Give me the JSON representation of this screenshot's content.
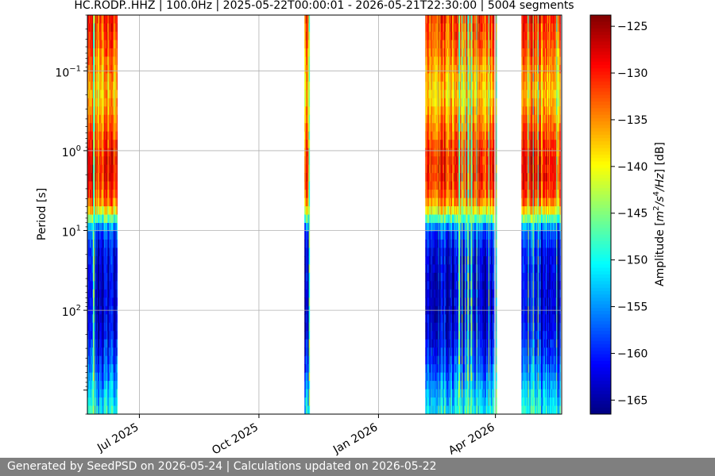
{
  "chart_data": {
    "type": "heatmap",
    "title": "HC.RODP..HHZ | 100.0Hz | 2025-05-22T00:00:01 - 2026-05-21T22:30:00 | 5004 segments",
    "xlabel": "",
    "ylabel": "Period [s]",
    "x_range": [
      "2025-05-22",
      "2026-05-21"
    ],
    "y_range": [
      0.02,
      2000
    ],
    "y_scale": "log",
    "y_inverted": true,
    "y_tick_labels": [
      {
        "value": 0.1,
        "base": "10",
        "exp": "−1"
      },
      {
        "value": 1,
        "base": "10",
        "exp": "0"
      },
      {
        "value": 10,
        "base": "10",
        "exp": "1"
      },
      {
        "value": 100,
        "base": "10",
        "exp": "2"
      }
    ],
    "x_ticks": [
      {
        "date": "2025-07-01",
        "label": "Jul 2025"
      },
      {
        "date": "2025-10-01",
        "label": "Oct 2025"
      },
      {
        "date": "2026-01-01",
        "label": "Jan 2026"
      },
      {
        "date": "2026-04-01",
        "label": "Apr 2026"
      }
    ],
    "grid": true,
    "colormap": "jet",
    "colorbar": {
      "label_prefix": "Amplitude [",
      "label_units": "m²/s⁴/Hz",
      "label_suffix": "] [dB]",
      "range": [
        -166.5,
        -123.8
      ],
      "ticks": [
        -125,
        -130,
        -135,
        -140,
        -145,
        -150,
        -155,
        -160,
        -165
      ],
      "tick_labels": [
        "−125",
        "−130",
        "−135",
        "−140",
        "−145",
        "−150",
        "−155",
        "−160",
        "−165"
      ]
    },
    "data_coverage": [
      {
        "start": "2025-05-22",
        "end": "2025-06-14"
      },
      {
        "start": "2025-11-05",
        "end": "2025-11-09"
      },
      {
        "start": "2026-02-06",
        "end": "2026-03-31"
      },
      {
        "start": "2026-04-01",
        "end": "2026-04-02"
      },
      {
        "start": "2026-04-21",
        "end": "2026-05-21"
      }
    ],
    "spectrum_profile": {
      "period": [
        0.02,
        0.05,
        0.1,
        0.2,
        0.5,
        1,
        2,
        4,
        6,
        10,
        20,
        50,
        100,
        200,
        500,
        2000
      ],
      "amplitude": [
        -131,
        -133,
        -136,
        -138,
        -134,
        -131,
        -130,
        -133,
        -141,
        -158,
        -162,
        -163,
        -163,
        -162,
        -158,
        -150
      ]
    }
  },
  "footer": "Generated by SeedPSD on 2026-05-24 | Calculations updated on 2026-05-22"
}
